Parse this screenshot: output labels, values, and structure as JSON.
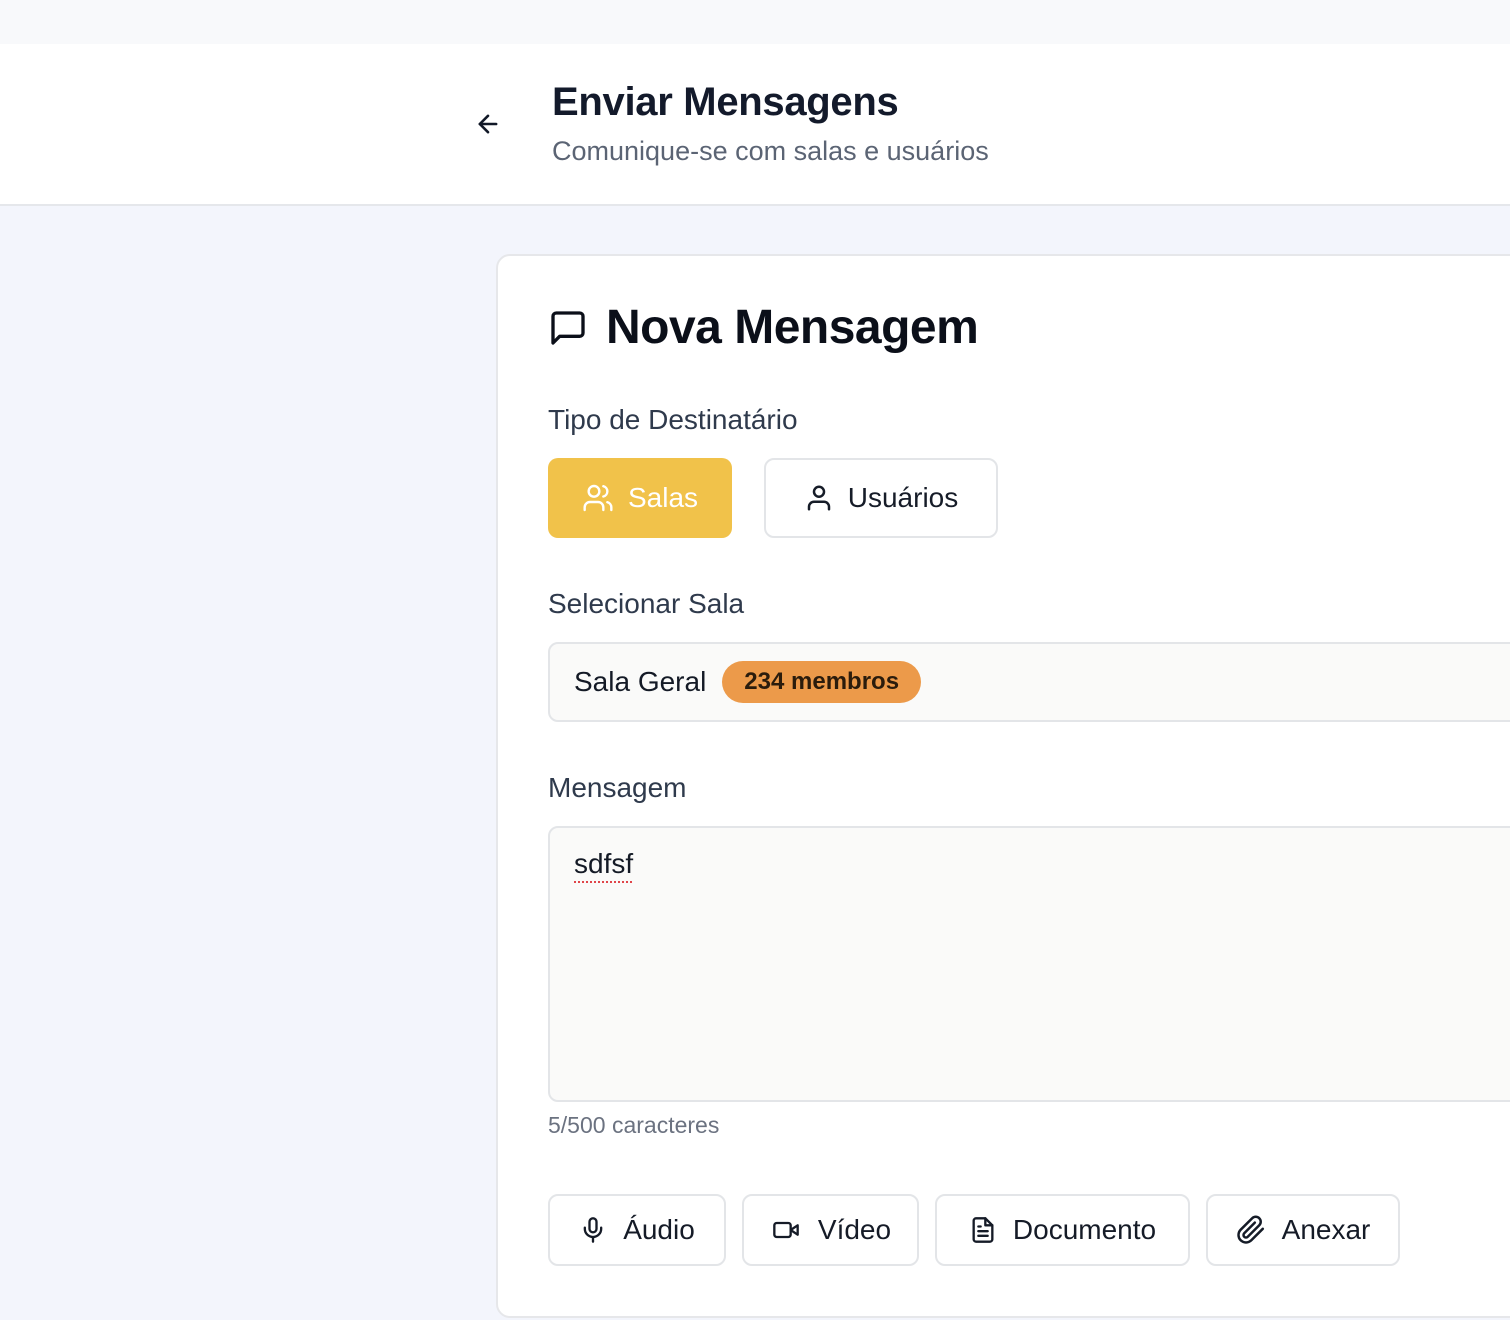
{
  "header": {
    "title": "Enviar Mensagens",
    "subtitle": "Comunique-se com salas e usuários"
  },
  "card": {
    "title": "Nova Mensagem",
    "recipient_type_label": "Tipo de Destinatário",
    "recipient_types": [
      {
        "label": "Salas",
        "icon": "users-icon",
        "active": true
      },
      {
        "label": "Usuários",
        "icon": "user-icon",
        "active": false
      }
    ],
    "select_room_label": "Selecionar Sala",
    "selected_room": {
      "name": "Sala Geral",
      "members": "234 membros"
    },
    "message_label": "Mensagem",
    "message_value": "sdfsf",
    "char_count": "5/500 caracteres",
    "attachments": [
      {
        "label": "Áudio",
        "icon": "mic-icon"
      },
      {
        "label": "Vídeo",
        "icon": "video-icon"
      },
      {
        "label": "Documento",
        "icon": "document-icon"
      },
      {
        "label": "Anexar",
        "icon": "paperclip-icon"
      }
    ]
  },
  "colors": {
    "accent": "#f1c24a",
    "badge": "#ec9a4a"
  }
}
